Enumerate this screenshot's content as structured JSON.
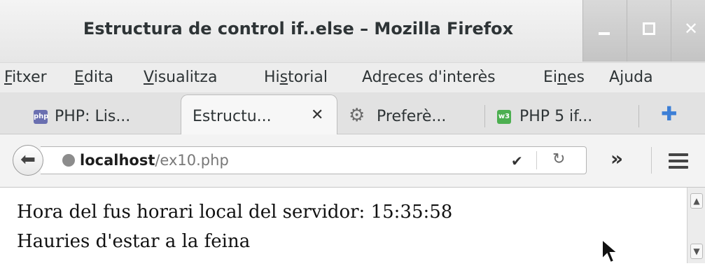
{
  "window": {
    "title": "Estructura de control if..else – Mozilla Firefox"
  },
  "menu": {
    "items": [
      {
        "pre": "",
        "acc": "F",
        "post": "itxer"
      },
      {
        "pre": "",
        "acc": "E",
        "post": "dita"
      },
      {
        "pre": "",
        "acc": "V",
        "post": "isualitza"
      },
      {
        "pre": "Hi",
        "acc": "s",
        "post": "torial"
      },
      {
        "pre": "Ad",
        "acc": "r",
        "post": "eces d'interès"
      },
      {
        "pre": "Ei",
        "acc": "n",
        "post": "es"
      },
      {
        "pre": "A",
        "acc": "j",
        "post": "uda"
      }
    ]
  },
  "tabs": [
    {
      "label": "PHP: Lis...",
      "icon": "php-favicon"
    },
    {
      "label": "Estructu...",
      "icon": "none",
      "active": true
    },
    {
      "label": "Preferè...",
      "icon": "gear-icon"
    },
    {
      "label": "PHP 5 if...",
      "icon": "w3-favicon"
    }
  ],
  "navbar": {
    "url_host": "localhost",
    "url_path": "/ex10.php"
  },
  "content": {
    "line1": "Hora del fus horari local del servidor: 15:35:58",
    "line2": "Hauries d'estar a la feina"
  },
  "colors": {
    "newtab_plus": "#3d7fd6",
    "php_favicon": "#6a6fb0",
    "w3_favicon": "#4caf50"
  }
}
